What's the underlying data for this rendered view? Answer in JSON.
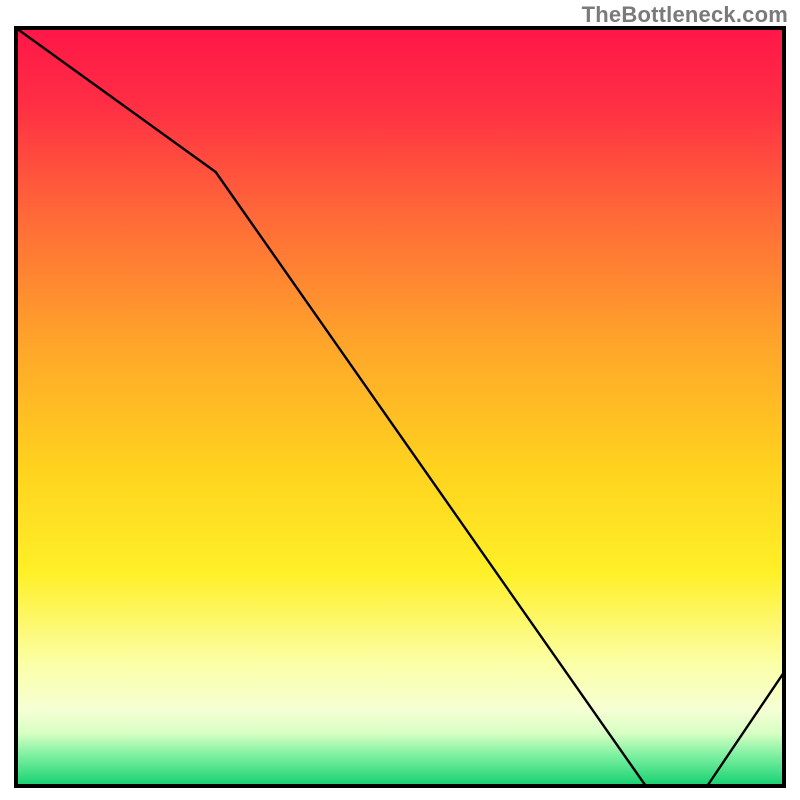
{
  "watermark": "TheBottleneck.com",
  "good_marker_label": "",
  "colors": {
    "frame": "#000000",
    "line": "#000000",
    "label": "#b04020"
  },
  "chart_data": {
    "type": "line",
    "title": "",
    "xlabel": "",
    "ylabel": "",
    "xlim": [
      0,
      100
    ],
    "ylim": [
      0,
      100
    ],
    "grid": false,
    "x": [
      0,
      26,
      82,
      90,
      100
    ],
    "values": [
      100,
      81,
      0,
      0,
      15
    ],
    "annotations": [
      {
        "x": 86,
        "y": 1.5,
        "text": ""
      }
    ],
    "gradient_stops": [
      {
        "offset": 0.0,
        "color": "#ff1648"
      },
      {
        "offset": 0.1,
        "color": "#ff2e44"
      },
      {
        "offset": 0.25,
        "color": "#ff6a38"
      },
      {
        "offset": 0.42,
        "color": "#ffa62a"
      },
      {
        "offset": 0.58,
        "color": "#ffd21e"
      },
      {
        "offset": 0.72,
        "color": "#fff028"
      },
      {
        "offset": 0.84,
        "color": "#fbffa8"
      },
      {
        "offset": 0.9,
        "color": "#f5ffd4"
      },
      {
        "offset": 0.93,
        "color": "#d8ffc4"
      },
      {
        "offset": 0.96,
        "color": "#7cf0a0"
      },
      {
        "offset": 1.0,
        "color": "#14d070"
      }
    ]
  }
}
